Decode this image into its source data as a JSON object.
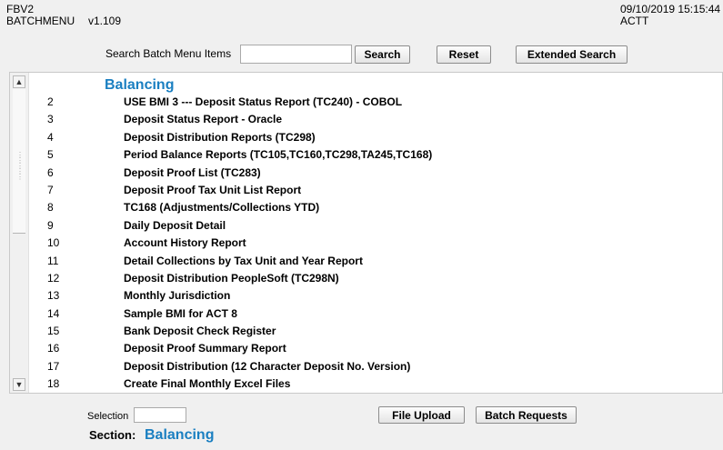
{
  "header": {
    "app_code": "FBV2",
    "menu_name": "BATCHMENU",
    "version": "v1.109",
    "datetime": "09/10/2019 15:15:44",
    "env": "ACTT"
  },
  "search": {
    "label": "Search Batch Menu Items",
    "value": "",
    "search_button": "Search",
    "reset_button": "Reset",
    "extended_button": "Extended Search"
  },
  "list": {
    "section_title": "Balancing",
    "items": [
      {
        "num": "2",
        "label": "USE BMI 3 --- Deposit Status Report (TC240) - COBOL"
      },
      {
        "num": "3",
        "label": "Deposit Status Report - Oracle"
      },
      {
        "num": "4",
        "label": "Deposit Distribution Reports (TC298)"
      },
      {
        "num": "5",
        "label": "Period Balance Reports (TC105,TC160,TC298,TA245,TC168)"
      },
      {
        "num": "6",
        "label": "Deposit Proof List (TC283)"
      },
      {
        "num": "7",
        "label": "Deposit Proof Tax Unit List Report"
      },
      {
        "num": "8",
        "label": "TC168 (Adjustments/Collections YTD)"
      },
      {
        "num": "9",
        "label": "Daily Deposit Detail"
      },
      {
        "num": "10",
        "label": "Account History Report"
      },
      {
        "num": "11",
        "label": "Detail Collections by Tax Unit and Year Report"
      },
      {
        "num": "12",
        "label": "Deposit Distribution PeopleSoft (TC298N)"
      },
      {
        "num": "13",
        "label": "Monthly Jurisdiction"
      },
      {
        "num": "14",
        "label": "Sample BMI for ACT 8"
      },
      {
        "num": "15",
        "label": "Bank Deposit Check Register"
      },
      {
        "num": "16",
        "label": "Deposit Proof Summary Report"
      },
      {
        "num": "17",
        "label": "Deposit Distribution (12 Character Deposit No. Version)"
      },
      {
        "num": "18",
        "label": "Create Final Monthly Excel Files"
      }
    ]
  },
  "footer": {
    "selection_label": "Selection",
    "selection_value": "",
    "file_upload_button": "File Upload",
    "batch_requests_button": "Batch Requests",
    "section_label": "Section:",
    "section_value": "Balancing"
  },
  "icons": {
    "scroll_up": "scroll-up-arrow-icon",
    "scroll_down": "scroll-down-arrow-icon"
  },
  "colors": {
    "section_title": "#1a7fc1",
    "background": "#f0f0f0"
  }
}
